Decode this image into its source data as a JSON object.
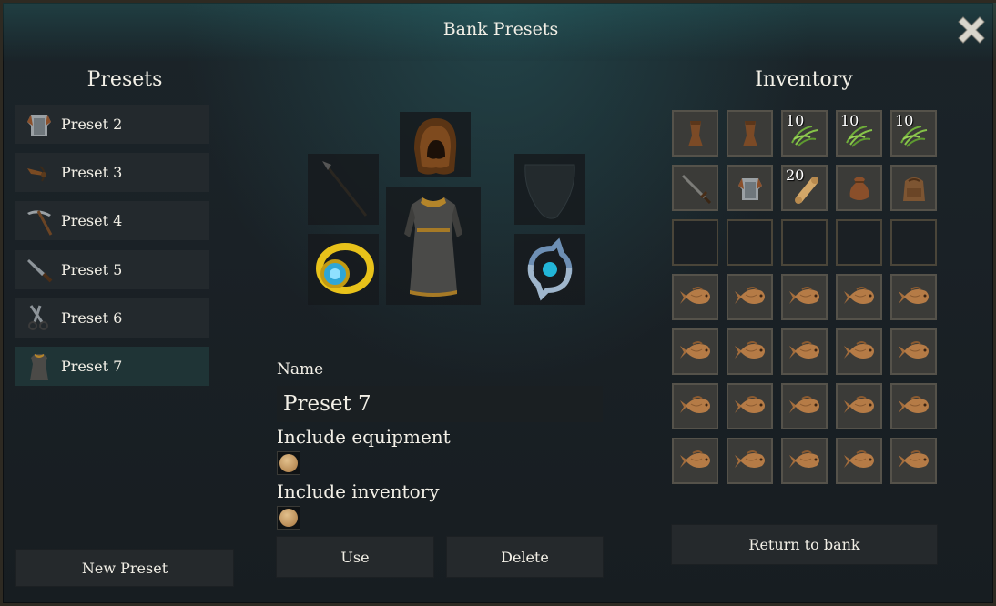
{
  "title": "Bank Presets",
  "presets_heading": "Presets",
  "inventory_heading": "Inventory",
  "presets": [
    {
      "label": "Preset 2",
      "icon": "armor-chestplate-icon"
    },
    {
      "label": "Preset 3",
      "icon": "crossbow-icon"
    },
    {
      "label": "Preset 4",
      "icon": "pickaxe-icon"
    },
    {
      "label": "Preset 5",
      "icon": "knife-icon"
    },
    {
      "label": "Preset 6",
      "icon": "shears-icon"
    },
    {
      "label": "Preset 7",
      "icon": "robe-icon"
    }
  ],
  "selected_preset": "Preset 7",
  "new_preset_label": "New Preset",
  "equipment": {
    "head": "hood-icon",
    "weapon": "spear-icon",
    "body": "robe-icon",
    "shield": "shield-silhouette-icon",
    "ring": "gold-ring-icon",
    "amulet": "rune-amulet-icon"
  },
  "name_label": "Name",
  "name_value": "Preset 7",
  "include_equipment_label": "Include equipment",
  "include_equipment_checked": true,
  "include_inventory_label": "Include inventory",
  "include_inventory_checked": true,
  "use_label": "Use",
  "delete_label": "Delete",
  "return_label": "Return to bank",
  "inventory": [
    {
      "icon": "wooden-leg-icon",
      "qty": ""
    },
    {
      "icon": "wooden-leg-icon",
      "qty": ""
    },
    {
      "icon": "herb-icon",
      "qty": "10"
    },
    {
      "icon": "herb-icon",
      "qty": "10"
    },
    {
      "icon": "herb-icon",
      "qty": "10"
    },
    {
      "icon": "sword-icon",
      "qty": ""
    },
    {
      "icon": "armor-chestplate-icon",
      "qty": ""
    },
    {
      "icon": "scroll-icon",
      "qty": "20"
    },
    {
      "icon": "pouch-icon",
      "qty": ""
    },
    {
      "icon": "backpack-icon",
      "qty": ""
    },
    {
      "icon": "empty",
      "qty": ""
    },
    {
      "icon": "empty",
      "qty": ""
    },
    {
      "icon": "empty",
      "qty": ""
    },
    {
      "icon": "empty",
      "qty": ""
    },
    {
      "icon": "empty",
      "qty": ""
    },
    {
      "icon": "fish-icon",
      "qty": ""
    },
    {
      "icon": "fish-icon",
      "qty": ""
    },
    {
      "icon": "fish-icon",
      "qty": ""
    },
    {
      "icon": "fish-icon",
      "qty": ""
    },
    {
      "icon": "fish-icon",
      "qty": ""
    },
    {
      "icon": "fish-icon",
      "qty": ""
    },
    {
      "icon": "fish-icon",
      "qty": ""
    },
    {
      "icon": "fish-icon",
      "qty": ""
    },
    {
      "icon": "fish-icon",
      "qty": ""
    },
    {
      "icon": "fish-icon",
      "qty": ""
    },
    {
      "icon": "fish-icon",
      "qty": ""
    },
    {
      "icon": "fish-icon",
      "qty": ""
    },
    {
      "icon": "fish-icon",
      "qty": ""
    },
    {
      "icon": "fish-icon",
      "qty": ""
    },
    {
      "icon": "fish-icon",
      "qty": ""
    },
    {
      "icon": "fish-icon",
      "qty": ""
    },
    {
      "icon": "fish-icon",
      "qty": ""
    },
    {
      "icon": "fish-icon",
      "qty": ""
    },
    {
      "icon": "fish-icon",
      "qty": ""
    },
    {
      "icon": "fish-icon",
      "qty": ""
    }
  ]
}
